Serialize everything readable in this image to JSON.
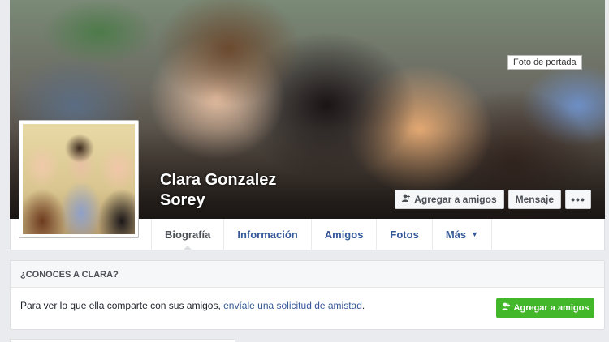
{
  "cover": {
    "tooltip": "Foto de portada"
  },
  "profile": {
    "name_line1": "Clara Gonzalez",
    "name_line2": "Sorey"
  },
  "actions": {
    "add_friend_label": "Agregar a amigos",
    "add_friend_icon": "person-plus-icon",
    "message_label": "Mensaje",
    "more_label": "•••"
  },
  "tabs": [
    {
      "label": "Biografía",
      "active": true
    },
    {
      "label": "Información",
      "active": false
    },
    {
      "label": "Amigos",
      "active": false
    },
    {
      "label": "Fotos",
      "active": false
    },
    {
      "label": "Más",
      "active": false
    }
  ],
  "know_card": {
    "title": "¿CONOCES A CLARA?",
    "text_prefix": "Para ver lo que ella comparte con sus amigos, ",
    "text_link": "envíale una solicitud de amistad",
    "text_suffix": ".",
    "button_label": "Agregar a amigos"
  },
  "colors": {
    "link": "#365899",
    "add_button": "#42b72a",
    "page_bg": "#e9ebee"
  }
}
